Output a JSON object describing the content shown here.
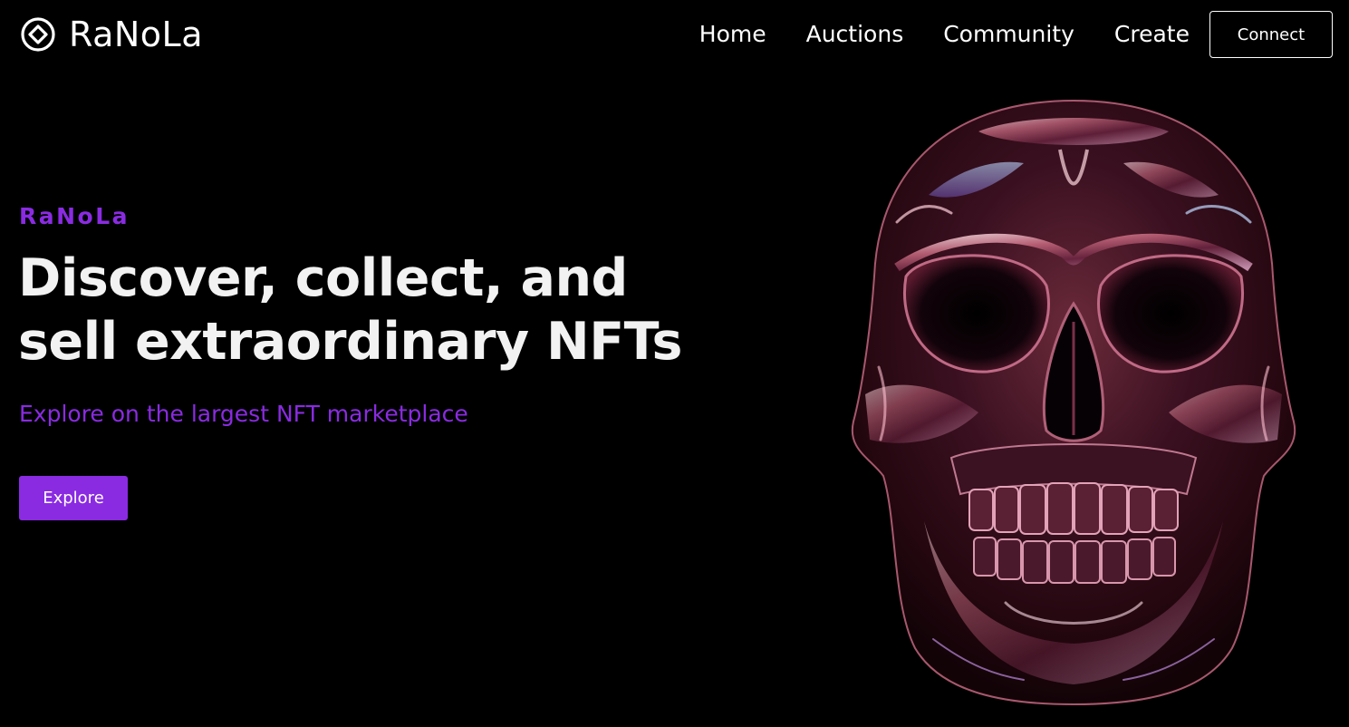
{
  "header": {
    "logo_text": "RaNoLa",
    "nav": [
      {
        "label": "Home"
      },
      {
        "label": "Auctions"
      },
      {
        "label": "Community"
      },
      {
        "label": "Create"
      }
    ],
    "connect_label": "Connect"
  },
  "hero": {
    "eyebrow": "RaNoLa",
    "headline_line1": "Discover, collect, and",
    "headline_line2": "sell extraordinary NFTs",
    "subheadline": "Explore on the largest NFT marketplace",
    "explore_label": "Explore"
  },
  "colors": {
    "background": "#000000",
    "text": "#ffffff",
    "accent": "#8a2be2"
  },
  "icons": {
    "logo": "diamond-in-circle-icon"
  }
}
